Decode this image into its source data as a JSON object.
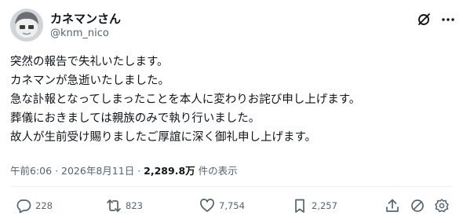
{
  "user": {
    "display_name": "カネマンさん",
    "handle": "@knm_nico"
  },
  "post": {
    "lines": [
      "突然の報告で失礼いたします。",
      "カネマンが急逝いたしました。",
      "急な訃報となってしまったことを本人に変わりお詫び申し上げます。",
      "葬儀におきましては親族のみで執り行いました。",
      "故人が生前受け賜りましたご厚誼に深く御礼申し上げます。"
    ],
    "time": "午前6:06",
    "separator": "·",
    "date": "2026年8月11日",
    "views_count": "2,289.8万",
    "views_label": "件の表示"
  },
  "actions": {
    "replies": "228",
    "reposts": "823",
    "likes": "7,754",
    "bookmarks": "2,257"
  },
  "icons": {
    "grok": "grok-icon",
    "more": "more-icon",
    "reply": "reply-icon",
    "repost": "repost-icon",
    "like": "heart-icon",
    "bookmark": "bookmark-icon",
    "share": "share-icon",
    "block": "block-icon",
    "settings": "gear-icon"
  },
  "colors": {
    "text": "#0f1419",
    "secondary": "#536471",
    "divider": "#eff3f4"
  }
}
